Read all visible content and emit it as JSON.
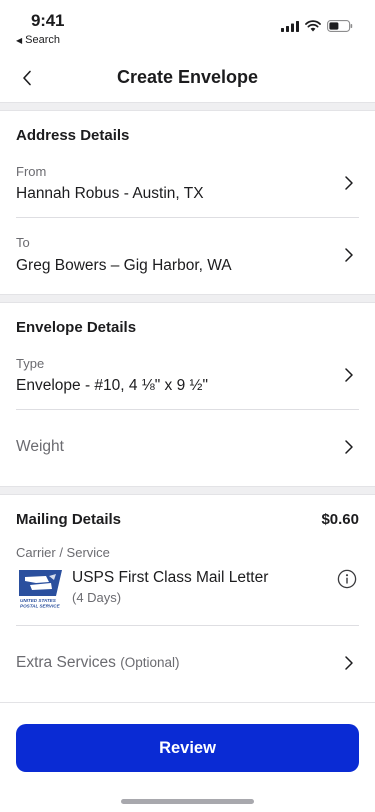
{
  "status_bar": {
    "time": "9:41",
    "back_app_label": "Search",
    "icons": [
      "cellular-signal-icon",
      "wifi-icon",
      "battery-icon"
    ]
  },
  "nav": {
    "title": "Create Envelope",
    "back_icon": "chevron-left-icon"
  },
  "address_details": {
    "title": "Address Details",
    "from_label": "From",
    "from_value": "Hannah Robus - Austin, TX",
    "to_label": "To",
    "to_value": "Greg Bowers – Gig Harbor, WA"
  },
  "envelope_details": {
    "title": "Envelope Details",
    "type_label": "Type",
    "type_value": "Envelope - #10, 4 ⅛\" x 9 ½\"",
    "weight_label": "Weight"
  },
  "mailing_details": {
    "title": "Mailing Details",
    "price": "$0.60",
    "carrier_label": "Carrier / Service",
    "service_name": "USPS First Class Mail Letter",
    "service_days": "(4 Days)",
    "logo_text_line1": "UNITED STATES",
    "logo_text_line2": "POSTAL SERVICE",
    "extra_services_label": "Extra Services",
    "extra_services_optional": "(Optional)"
  },
  "footer": {
    "review_label": "Review"
  },
  "colors": {
    "primary": "#0a2bd4",
    "usps_blue": "#2a4f9e",
    "separator_bg": "#efeff1",
    "secondary_text": "#6b6b70"
  }
}
